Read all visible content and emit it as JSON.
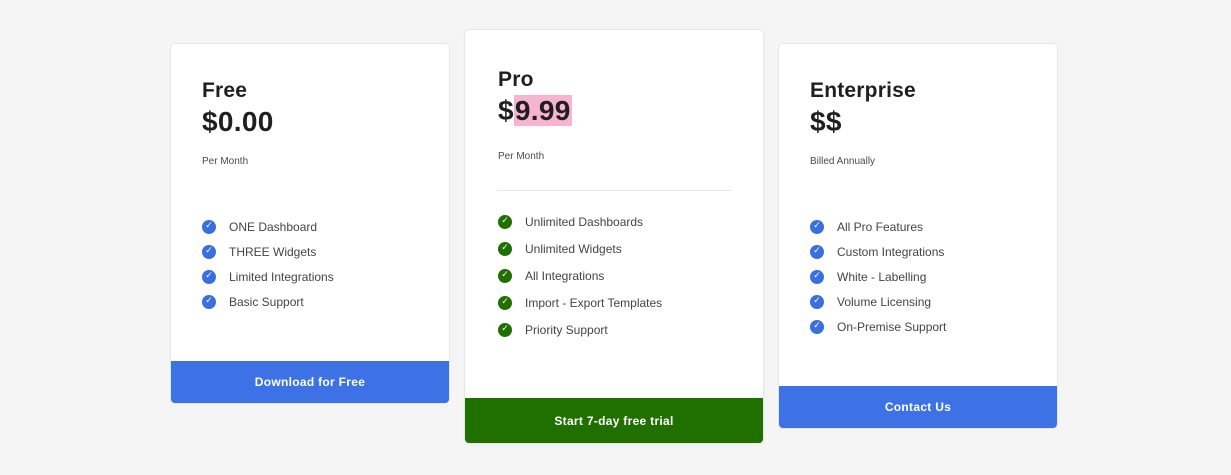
{
  "colors": {
    "page_bg": "#f5f5f5",
    "card_bg": "#ffffff",
    "blue_accent": "#3c72e6",
    "green_accent": "#1f7000",
    "price_highlight": "#f7b3cf"
  },
  "plans": {
    "free": {
      "name": "Free",
      "price": "$0.00",
      "period": "Per Month",
      "features": [
        "ONE Dashboard",
        "THREE Widgets",
        "Limited Integrations",
        "Basic Support"
      ],
      "check_icon": "check-circle-icon",
      "cta_label": "Download for Free"
    },
    "pro": {
      "name": "Pro",
      "price_symbol": "$",
      "price_value": "9.99",
      "period": "Per Month",
      "features": [
        "Unlimited Dashboards",
        "Unlimited Widgets",
        "All Integrations",
        "Import - Export Templates",
        "Priority Support"
      ],
      "check_icon": "check-circle-icon",
      "cta_label": "Start 7-day free trial"
    },
    "enterprise": {
      "name": "Enterprise",
      "price": "$$",
      "period": "Billed Annually",
      "features": [
        "All Pro Features",
        "Custom Integrations",
        "White - Labelling",
        "Volume Licensing",
        "On-Premise Support"
      ],
      "check_icon": "check-circle-icon",
      "cta_label": "Contact Us"
    }
  }
}
